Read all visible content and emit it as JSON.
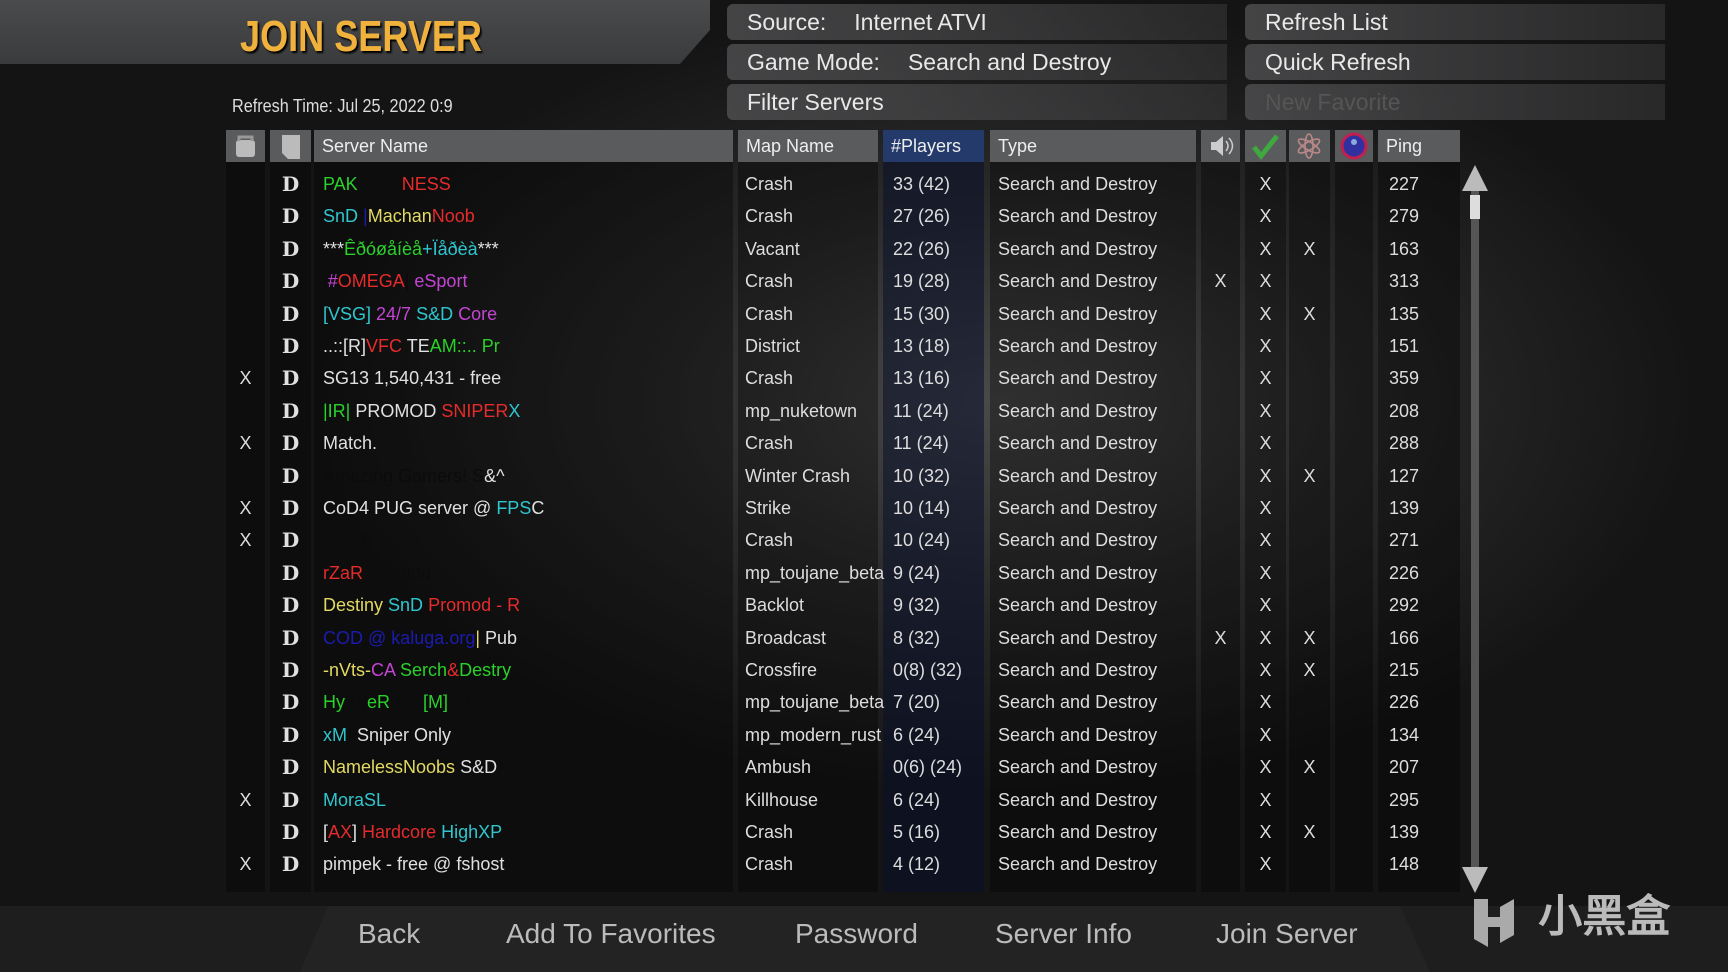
{
  "title": "JOIN SERVER",
  "refresh_time": "Refresh Time: Jul 25, 2022  0:9",
  "menu": {
    "source_label": "Source:",
    "source_value": "Internet ATVI",
    "mode_label": "Game Mode:",
    "mode_value": "Search and Destroy",
    "filter": "Filter Servers",
    "refresh_list": "Refresh List",
    "quick_refresh": "Quick Refresh",
    "new_favorite": "New Favorite"
  },
  "columns": {
    "server_name": "Server Name",
    "map_name": "Map Name",
    "players": "#Players",
    "type": "Type",
    "ping": "Ping",
    "icons": [
      "lock-icon",
      "dedicated-icon",
      "voice-icon",
      "pure-icon",
      "mod-icon",
      "punkbuster-icon"
    ]
  },
  "colors": {
    "green": "#2ad12a",
    "red": "#e52b2b",
    "black": "#0c0c0c",
    "cyan": "#2fc6cf",
    "yellow": "#e2da62",
    "magenta": "#c444d4",
    "blue": "#1b1bb0",
    "white": "#e0e0e0",
    "title": "#f0b23c",
    "selected_header": "#243a6a"
  },
  "rows": [
    {
      "pw": "",
      "name": [
        [
          "PAK ",
          "green"
        ],
        [
          "PRO",
          "black"
        ],
        [
          "NESS",
          "red"
        ]
      ],
      "map": "Crash",
      "players": "33 (42)",
      "type": "Search and Destroy",
      "voice": "",
      "pure": "X",
      "mod": "",
      "ping": "227"
    },
    {
      "pw": "",
      "name": [
        [
          "SnD ",
          "cyan"
        ],
        [
          "|",
          "blue"
        ],
        [
          "Machan",
          "yellow"
        ],
        [
          "Noob",
          "red"
        ]
      ],
      "map": "Crash",
      "players": "27 (26)",
      "type": "Search and Destroy",
      "voice": "",
      "pure": "X",
      "mod": "",
      "ping": "279"
    },
    {
      "pw": "",
      "name": [
        [
          "***",
          "white"
        ],
        [
          "Êðóøåíèå",
          "green"
        ],
        [
          "+Ïåðèà",
          "cyan"
        ],
        [
          "***",
          "white"
        ]
      ],
      "map": "Vacant",
      "players": "22 (26)",
      "type": "Search and Destroy",
      "voice": "",
      "pure": "X",
      "mod": "X",
      "ping": "163"
    },
    {
      "pw": "",
      "name": [
        [
          "|",
          "black"
        ],
        [
          "#",
          "magenta"
        ],
        [
          "OMEGA",
          "red"
        ],
        [
          "|",
          "black"
        ],
        [
          " eSport",
          "magenta"
        ]
      ],
      "map": "Crash",
      "players": "19 (28)",
      "type": "Search and Destroy",
      "voice": "X",
      "pure": "X",
      "mod": "",
      "ping": "313"
    },
    {
      "pw": "",
      "name": [
        [
          "[VSG] ",
          "cyan"
        ],
        [
          "24/7 ",
          "magenta"
        ],
        [
          "S&D ",
          "cyan"
        ],
        [
          "Core",
          "magenta"
        ]
      ],
      "map": "Crash",
      "players": "15 (30)",
      "type": "Search and Destroy",
      "voice": "",
      "pure": "X",
      "mod": "X",
      "ping": "135"
    },
    {
      "pw": "",
      "name": [
        [
          "..::[R]",
          "white"
        ],
        [
          "VFC ",
          "red"
        ],
        [
          "TE",
          "white"
        ],
        [
          "AM::.. Pr",
          "green"
        ]
      ],
      "map": "District",
      "players": "13 (18)",
      "type": "Search and Destroy",
      "voice": "",
      "pure": "X",
      "mod": "",
      "ping": "151"
    },
    {
      "pw": "X",
      "name": [
        [
          "SG13 1,540,431 - free",
          "white"
        ]
      ],
      "map": "Crash",
      "players": "13 (16)",
      "type": "Search and Destroy",
      "voice": "",
      "pure": "X",
      "mod": "",
      "ping": "359"
    },
    {
      "pw": "",
      "name": [
        [
          "|IR| ",
          "green"
        ],
        [
          "PROMOD ",
          "white"
        ],
        [
          "SNIPER",
          "red"
        ],
        [
          "X",
          "cyan"
        ]
      ],
      "map": "mp_nuketown",
      "players": "11 (24)",
      "type": "Search and Destroy",
      "voice": "",
      "pure": "X",
      "mod": "",
      "ping": "208"
    },
    {
      "pw": "X",
      "name": [
        [
          "Match.",
          "white"
        ]
      ],
      "map": "Crash",
      "players": "11 (24)",
      "type": "Search and Destroy",
      "voice": "",
      "pure": "X",
      "mod": "",
      "ping": "288"
    },
    {
      "pw": "",
      "name": [
        [
          "Amazing Gamers! S",
          "black"
        ],
        [
          "&^",
          "white"
        ]
      ],
      "map": "Winter Crash",
      "players": "10 (32)",
      "type": "Search and Destroy",
      "voice": "",
      "pure": "X",
      "mod": "X",
      "ping": "127"
    },
    {
      "pw": "X",
      "name": [
        [
          "CoD4 PUG server @ ",
          "white"
        ],
        [
          "FPS",
          "cyan"
        ],
        [
          "C",
          "white"
        ]
      ],
      "map": "Strike",
      "players": "10 (14)",
      "type": "Search and Destroy",
      "voice": "",
      "pure": "X",
      "mod": "",
      "ping": "139"
    },
    {
      "pw": "X",
      "name": [
        [
          "Match",
          "black"
        ]
      ],
      "map": "Crash",
      "players": "10 (24)",
      "type": "Search and Destroy",
      "voice": "",
      "pure": "X",
      "mod": "",
      "ping": "271"
    },
    {
      "pw": "",
      "name": [
        [
          "rZaR ",
          "red"
        ],
        [
          "Promod",
          "black"
        ]
      ],
      "map": "mp_toujane_beta",
      "players": "9 (24)",
      "type": "Search and Destroy",
      "voice": "",
      "pure": "X",
      "mod": "",
      "ping": "226"
    },
    {
      "pw": "",
      "name": [
        [
          "Destiny ",
          "yellow"
        ],
        [
          "SnD ",
          "cyan"
        ],
        [
          "Promod - R",
          "red"
        ]
      ],
      "map": "Backlot",
      "players": "9 (32)",
      "type": "Search and Destroy",
      "voice": "",
      "pure": "X",
      "mod": "",
      "ping": "292"
    },
    {
      "pw": "",
      "name": [
        [
          "COD @ kaluga.org",
          "blue"
        ],
        [
          "|",
          "yellow"
        ],
        [
          " Pub",
          "white"
        ]
      ],
      "map": "Broadcast",
      "players": "8 (32)",
      "type": "Search and Destroy",
      "voice": "X",
      "pure": "X",
      "mod": "X",
      "ping": "166"
    },
    {
      "pw": "",
      "name": [
        [
          "-nVts-",
          "yellow"
        ],
        [
          "CA ",
          "magenta"
        ],
        [
          "Serch",
          "green"
        ],
        [
          "&",
          "red"
        ],
        [
          "Destry",
          "green"
        ]
      ],
      "map": "Crossfire",
      "players": "0(8) (32)",
      "type": "Search and Destroy",
      "voice": "",
      "pure": "X",
      "mod": "X",
      "ping": "215"
    },
    {
      "pw": "",
      "name": [
        [
          "Hy",
          "green"
        ],
        [
          "[P]",
          "black"
        ],
        [
          "eR ",
          "green"
        ],
        [
          "Pro",
          "black"
        ],
        [
          "[M]",
          "green"
        ],
        [
          "oD",
          "black"
        ]
      ],
      "map": "mp_toujane_beta",
      "players": "7 (20)",
      "type": "Search and Destroy",
      "voice": "",
      "pure": "X",
      "mod": "",
      "ping": "226"
    },
    {
      "pw": "",
      "name": [
        [
          "xM",
          "cyan"
        ],
        [
          "#",
          "black"
        ],
        [
          "Sniper Only",
          "white"
        ]
      ],
      "map": "mp_modern_rust",
      "players": "6 (24)",
      "type": "Search and Destroy",
      "voice": "",
      "pure": "X",
      "mod": "",
      "ping": "134"
    },
    {
      "pw": "",
      "name": [
        [
          "NamelessNoobs ",
          "yellow"
        ],
        [
          "S&D",
          "white"
        ]
      ],
      "map": "Ambush",
      "players": "0(6) (24)",
      "type": "Search and Destroy",
      "voice": "",
      "pure": "X",
      "mod": "X",
      "ping": "207"
    },
    {
      "pw": "X",
      "name": [
        [
          "MoraSL",
          "cyan"
        ]
      ],
      "map": "Killhouse",
      "players": "6 (24)",
      "type": "Search and Destroy",
      "voice": "",
      "pure": "X",
      "mod": "",
      "ping": "295"
    },
    {
      "pw": "",
      "name": [
        [
          "[",
          "white"
        ],
        [
          "AX",
          "red"
        ],
        [
          "] ",
          "white"
        ],
        [
          "Hardcore ",
          "red"
        ],
        [
          "HighXP",
          "cyan"
        ]
      ],
      "map": "Crash",
      "players": "5 (16)",
      "type": "Search and Destroy",
      "voice": "",
      "pure": "X",
      "mod": "X",
      "ping": "139"
    },
    {
      "pw": "X",
      "name": [
        [
          "pimpek - free @ fshost",
          "white"
        ]
      ],
      "map": "Crash",
      "players": "4 (12)",
      "type": "Search and Destroy",
      "voice": "",
      "pure": "X",
      "mod": "",
      "ping": "148"
    }
  ],
  "dedicated_mark": "D",
  "bottom": {
    "back": "Back",
    "add_fav": "Add To Favorites",
    "password": "Password",
    "server_info": "Server Info",
    "join": "Join Server"
  },
  "watermark": "小黑盒"
}
